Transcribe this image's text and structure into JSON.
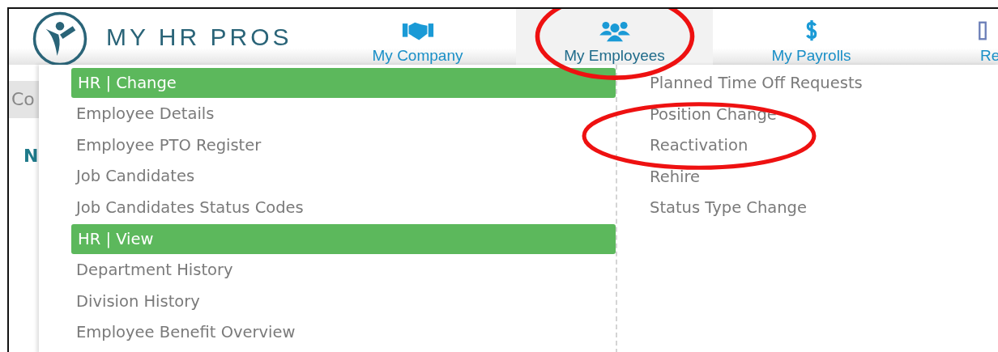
{
  "brand": {
    "name": "MY HR PROS"
  },
  "nav": [
    {
      "label": "My Company",
      "selected": false
    },
    {
      "label": "My Employees",
      "selected": true
    },
    {
      "label": "My Payrolls",
      "selected": false
    },
    {
      "label": "Re",
      "selected": false
    }
  ],
  "background": {
    "tab": "Co",
    "heading": "N"
  },
  "menu": {
    "left": [
      {
        "kind": "header",
        "label": "HR | Change"
      },
      {
        "kind": "link",
        "label": "Employee Details"
      },
      {
        "kind": "link",
        "label": "Employee PTO Register"
      },
      {
        "kind": "link",
        "label": "Job Candidates"
      },
      {
        "kind": "link",
        "label": "Job Candidates Status Codes"
      },
      {
        "kind": "header",
        "label": "HR | View"
      },
      {
        "kind": "link",
        "label": "Department History"
      },
      {
        "kind": "link",
        "label": "Division History"
      },
      {
        "kind": "link",
        "label": "Employee Benefit Overview"
      }
    ],
    "right": [
      {
        "kind": "link",
        "label": "Planned Time Off Requests"
      },
      {
        "kind": "link",
        "label": "Position Change"
      },
      {
        "kind": "link",
        "label": "Reactivation"
      },
      {
        "kind": "link",
        "label": "Rehire"
      },
      {
        "kind": "link",
        "label": "Status Type Change"
      }
    ]
  }
}
